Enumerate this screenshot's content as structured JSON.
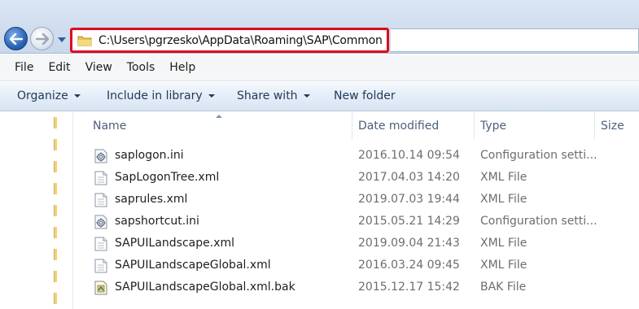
{
  "address_bar": {
    "path": "C:\\Users\\pgrzesko\\AppData\\Roaming\\SAP\\Common",
    "folder_icon": "folder-icon",
    "highlight_color": "#e00a1e"
  },
  "navigation": {
    "back_icon": "back-arrow-icon",
    "forward_icon": "forward-arrow-icon",
    "recent_icon": "chevron-down-icon"
  },
  "menu": [
    "File",
    "Edit",
    "View",
    "Tools",
    "Help"
  ],
  "commands": [
    {
      "label": "Organize",
      "dropdown": true
    },
    {
      "label": "Include in library",
      "dropdown": true
    },
    {
      "label": "Share with",
      "dropdown": true
    },
    {
      "label": "New folder",
      "dropdown": false
    }
  ],
  "columns": {
    "name": "Name",
    "date": "Date modified",
    "type": "Type",
    "size": "Size"
  },
  "files": [
    {
      "name": "saplogon.ini",
      "date": "2016.10.14 09:54",
      "type": "Configuration setti...",
      "icon": "config-file-icon"
    },
    {
      "name": "SapLogonTree.xml",
      "date": "2017.04.03 14:20",
      "type": "XML File",
      "icon": "document-icon"
    },
    {
      "name": "saprules.xml",
      "date": "2019.07.03 19:44",
      "type": "XML File",
      "icon": "document-icon"
    },
    {
      "name": "sapshortcut.ini",
      "date": "2015.05.21 14:29",
      "type": "Configuration setti...",
      "icon": "config-file-icon"
    },
    {
      "name": "SAPUILandscape.xml",
      "date": "2019.09.04 21:43",
      "type": "XML File",
      "icon": "document-icon"
    },
    {
      "name": "SAPUILandscapeGlobal.xml",
      "date": "2016.03.24 09:45",
      "type": "XML File",
      "icon": "document-icon"
    },
    {
      "name": "SAPUILandscapeGlobal.xml.bak",
      "date": "2015.12.17 15:42",
      "type": "BAK File",
      "icon": "bak-file-icon"
    }
  ]
}
